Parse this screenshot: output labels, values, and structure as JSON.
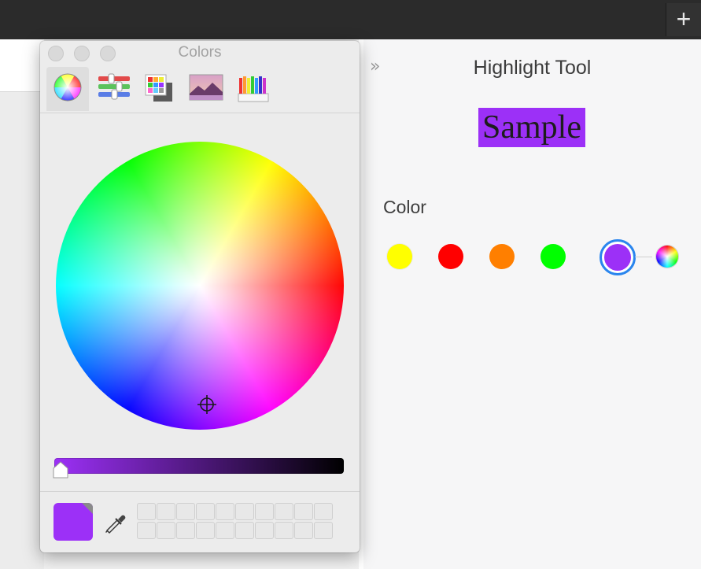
{
  "toolbar": {
    "add_button_label": "+"
  },
  "colors_panel": {
    "title": "Colors",
    "tabs": [
      {
        "name": "color-wheel",
        "icon": "color-wheel-icon",
        "active": true
      },
      {
        "name": "color-sliders",
        "icon": "color-sliders-icon",
        "active": false
      },
      {
        "name": "color-palettes",
        "icon": "color-palettes-icon",
        "active": false
      },
      {
        "name": "image-palettes",
        "icon": "image-palettes-icon",
        "active": false
      },
      {
        "name": "pencils",
        "icon": "pencils-icon",
        "active": false
      }
    ],
    "brightness_level": 1.0,
    "current_color": "#9c30f7",
    "swatch_slots": 20
  },
  "inspector": {
    "collapse_icon": "»",
    "title": "Highlight Tool",
    "sample_text": "Sample",
    "sample_highlight_color": "#9c30f7",
    "color_label": "Color",
    "color_options": [
      {
        "name": "yellow",
        "hex": "#ffff00",
        "selected": false
      },
      {
        "name": "red",
        "hex": "#ff0000",
        "selected": false
      },
      {
        "name": "orange",
        "hex": "#ff7f00",
        "selected": false
      },
      {
        "name": "green",
        "hex": "#00ff00",
        "selected": false
      },
      {
        "name": "purple",
        "hex": "#9c30f7",
        "selected": true
      }
    ],
    "custom_color_icon": "color-wheel-icon"
  }
}
